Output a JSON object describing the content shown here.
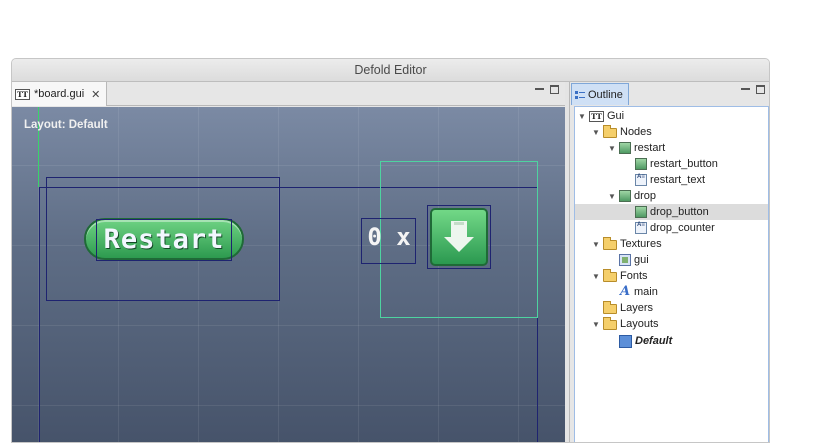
{
  "window": {
    "title": "Defold Editor"
  },
  "editor": {
    "tab_label": "*board.gui",
    "layout_label": "Layout: Default",
    "restart_button_text": "Restart",
    "drop_counter_text": "0 x"
  },
  "outline": {
    "tab_label": "Outline",
    "tree": [
      {
        "label": "Gui"
      },
      {
        "label": "Nodes"
      },
      {
        "label": "restart"
      },
      {
        "label": "restart_button"
      },
      {
        "label": "restart_text"
      },
      {
        "label": "drop"
      },
      {
        "label": "drop_button",
        "selected": true
      },
      {
        "label": "drop_counter"
      },
      {
        "label": "Textures"
      },
      {
        "label": "gui"
      },
      {
        "label": "Fonts"
      },
      {
        "label": "main"
      },
      {
        "label": "Layers"
      },
      {
        "label": "Layouts"
      },
      {
        "label": "Default"
      }
    ]
  }
}
